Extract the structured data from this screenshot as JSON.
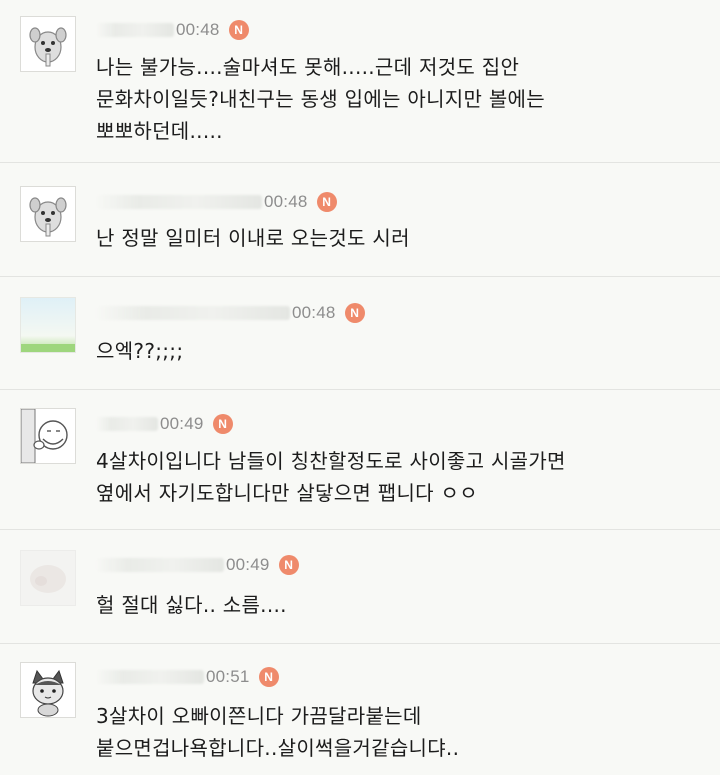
{
  "comments": [
    {
      "time": "00:48",
      "badge": "N",
      "avatar": "dog-avatar",
      "lines": [
        "나는 불가능....술마셔도 못해.....근데 저것도 집안",
        "문화차이일듯?내친구는 동생 입에는 아니지만 볼에는",
        "뽀뽀하던데....."
      ]
    },
    {
      "time": "00:48",
      "badge": "N",
      "avatar": "dog-avatar",
      "lines": [
        "난 정말 일미터 이내로 오는것도 시러"
      ]
    },
    {
      "time": "00:48",
      "badge": "N",
      "avatar": "landscape-photo-avatar",
      "lines": [
        "으엑??;;;;"
      ]
    },
    {
      "time": "00:49",
      "badge": "N",
      "avatar": "peeking-character-avatar",
      "lines": [
        "4살차이입니다 남들이 칭찬할정도로 사이좋고 시골가면",
        "옆에서 자기도합니다만 살닿으면 팹니다 ㅇㅇ"
      ]
    },
    {
      "time": "00:49",
      "badge": "N",
      "avatar": "blurred-photo-avatar",
      "lines": [
        "헐 절대 싫다.. 소름...."
      ]
    },
    {
      "time": "00:51",
      "badge": "N",
      "avatar": "cat-avatar",
      "lines": [
        "3살차이 오빠이쯘니다 가끔달라붙는데",
        "붙으면겁나욕합니다..살이썩을거같습니댜.."
      ]
    }
  ]
}
